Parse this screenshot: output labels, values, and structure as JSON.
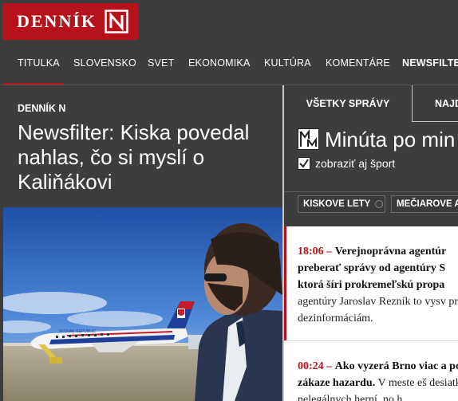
{
  "brand": {
    "name": "DENNÍK",
    "color": "#b5121b"
  },
  "nav": {
    "items": [
      {
        "label": "TITULKA",
        "active": false
      },
      {
        "label": "SLOVENSKO",
        "active": false
      },
      {
        "label": "SVET",
        "active": false
      },
      {
        "label": "EKONOMIKA",
        "active": false
      },
      {
        "label": "KULTÚRA",
        "active": false
      },
      {
        "label": "KOMENTÁRE",
        "active": false
      },
      {
        "label": "NEWSFILTER",
        "active": true
      }
    ]
  },
  "article": {
    "kicker": "DENNÍK N",
    "headline": "Newsfilter: Kiska povedal nahlas, čo si myslí o Kaliňákovi",
    "photo": {
      "livery_text": "SLOVAK REPUBLIC"
    }
  },
  "minute": {
    "tabs": {
      "all": "VŠETKY SPRÁVY",
      "find": "NAJD"
    },
    "title": "Minúta po min",
    "sport_label": "zobraziť aj šport",
    "sport_checked": true,
    "chips": [
      "KISKOVE LETY",
      "MEČIAROVE A"
    ],
    "items": [
      {
        "time": "18:06 –",
        "bold": "Verejnoprávna agentúr preberať správy od agentúry S ktorá šíri prokremeľskú propa",
        "text": "agentúry Jaroslav Rezník to vysv proti dezinformáciám."
      },
      {
        "time": "00:24 –",
        "bold": "Ako vyzerá Brno viac a po zákaze hazardu.",
        "text": "V meste eš desiatky nelegálnych herní, no h"
      }
    ]
  }
}
